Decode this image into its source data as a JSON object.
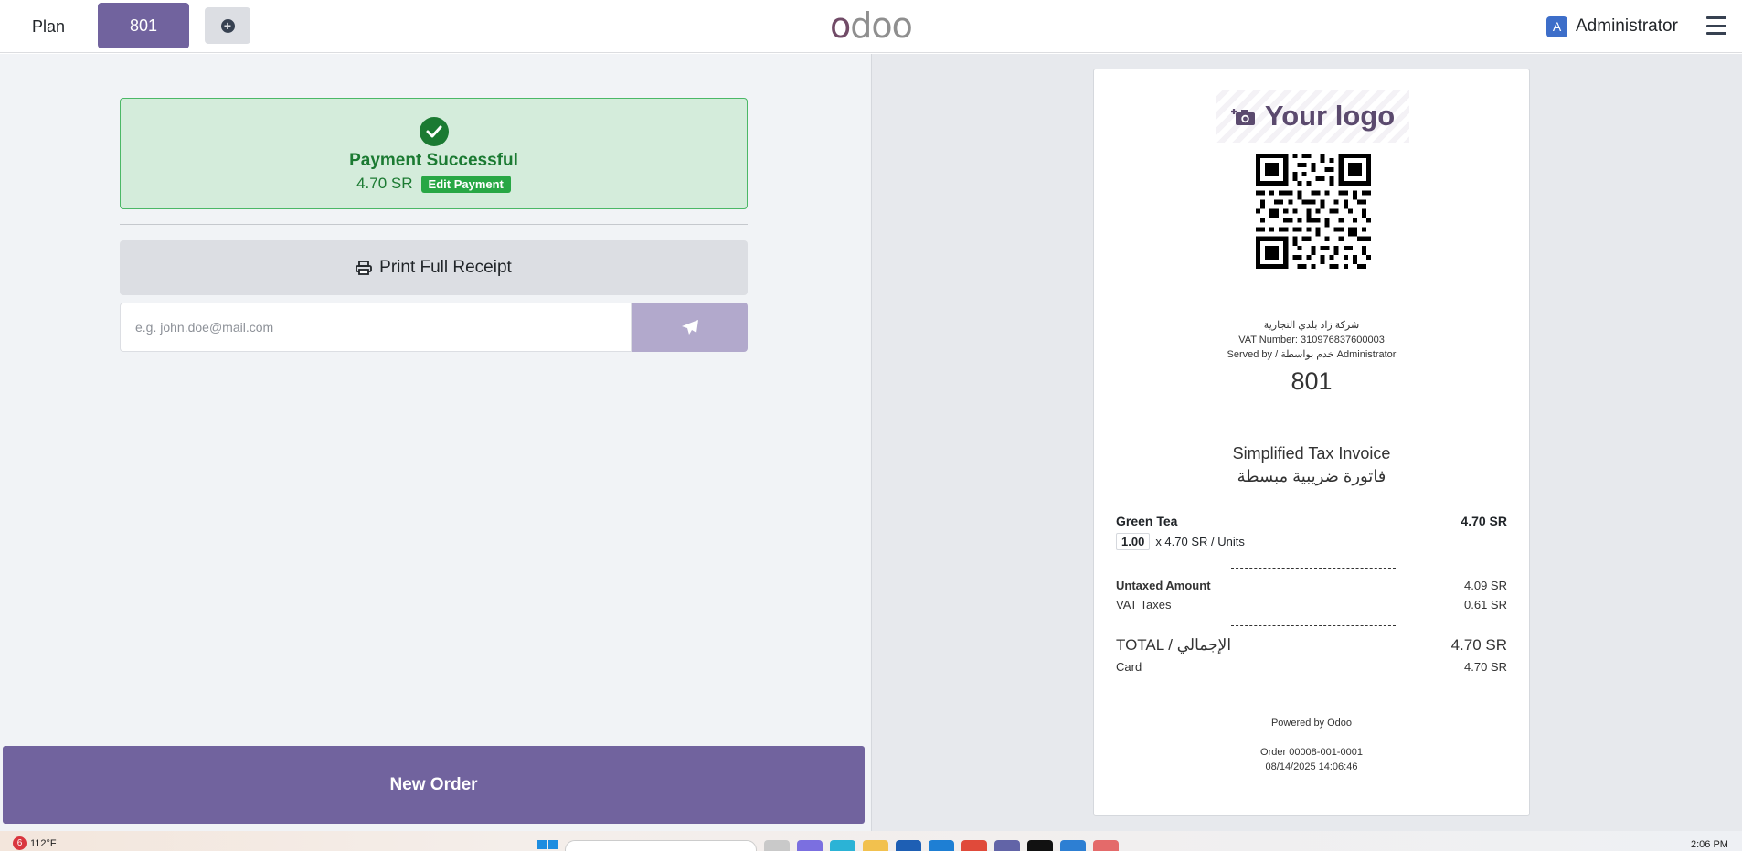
{
  "navbar": {
    "plan_label": "Plan",
    "order_tab_label": "801",
    "brand": {
      "o": "o",
      "rest": "doo"
    },
    "user_initial": "A",
    "user_name": "Administrator"
  },
  "payment_status": {
    "title": "Payment Successful",
    "amount": "4.70 SR",
    "edit_label": "Edit Payment"
  },
  "actions": {
    "print_label": "Print Full Receipt",
    "email_placeholder": "e.g. john.doe@mail.com",
    "new_order_label": "New Order"
  },
  "receipt": {
    "logo_text": "Your logo",
    "company_name": "شركة زاد بلدي التجارية",
    "vat_number": "VAT Number: 310976837600003",
    "served_by": "Served by / خدم بواسطة Administrator",
    "order_number": "801",
    "invoice_title_en": "Simplified Tax Invoice",
    "invoice_title_ar": "فاتورة ضريبية مبسطة",
    "line_items": [
      {
        "name": "Green Tea",
        "total": "4.70 SR",
        "qty": "1.00",
        "unit_price": "x 4.70 SR / Units"
      }
    ],
    "untaxed_label": "Untaxed Amount",
    "untaxed_value": "4.09 SR",
    "vat_label": "VAT Taxes",
    "vat_value": "0.61 SR",
    "total_label": "TOTAL / الإجمالي",
    "total_value": "4.70 SR",
    "payment_method": "Card",
    "payment_value": "4.70 SR",
    "powered_by": "Powered by Odoo",
    "order_ref": "Order 00008-001-0001",
    "order_datetime": "08/14/2025 14:06:46"
  },
  "taskbar": {
    "notification_count": "6",
    "temperature": "112°F",
    "clock": "2:06 PM"
  },
  "colors": {
    "primary": "#71639e",
    "success": "#1b7a32",
    "success_bg": "#d4ecdb"
  }
}
